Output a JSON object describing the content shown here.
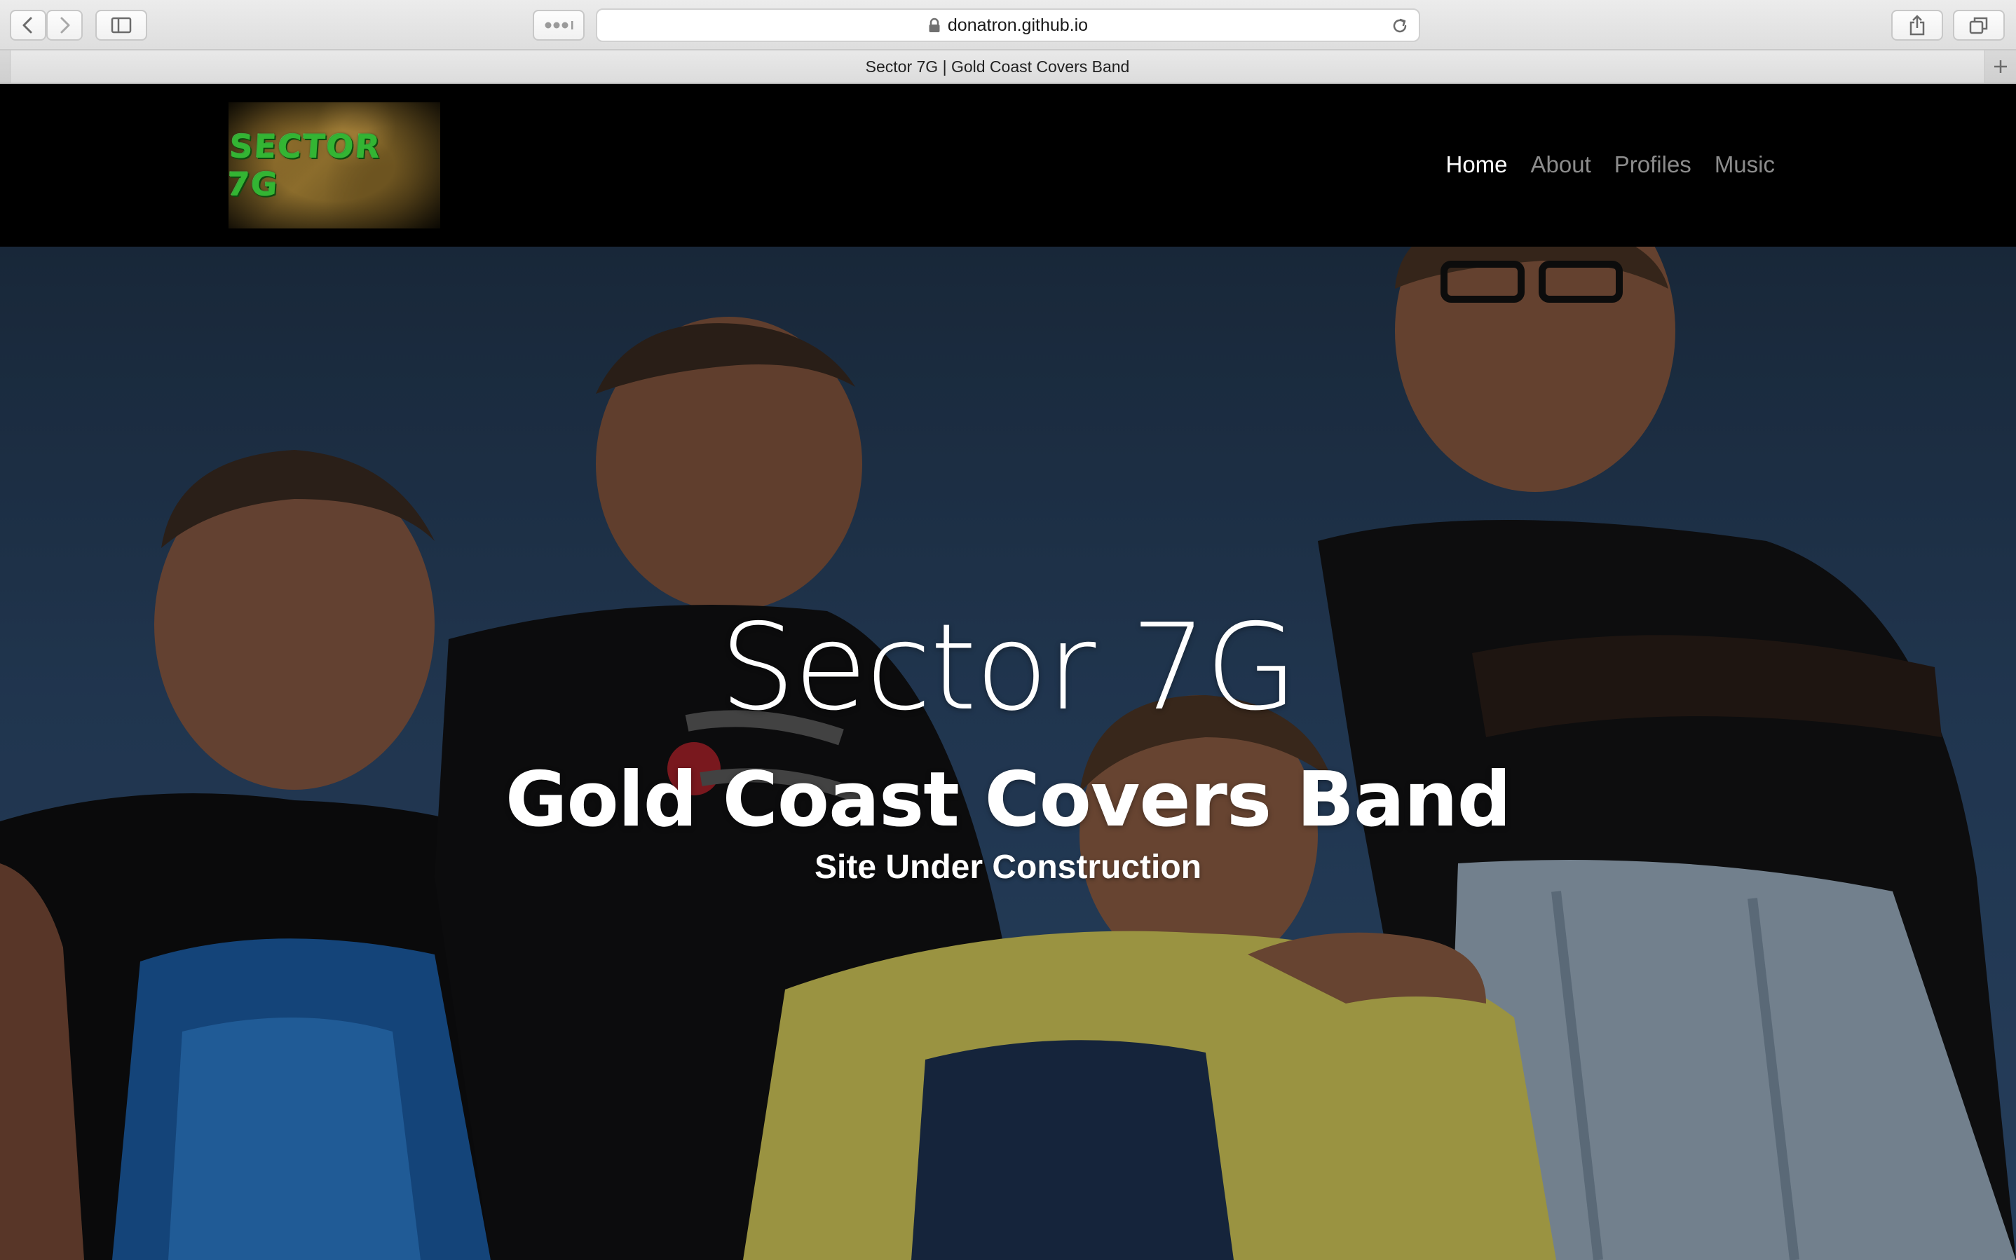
{
  "browser": {
    "url": "donatron.github.io",
    "tab_title": "Sector 7G | Gold Coast Covers Band",
    "icons": {
      "back": "chevron-left-icon",
      "forward": "chevron-right-icon",
      "sidebar": "sidebar-icon",
      "extensions": "ellipsis-icon",
      "lock": "lock-icon",
      "reload": "reload-icon",
      "share": "share-icon",
      "tabs": "tabs-overview-icon",
      "new_tab": "plus-icon"
    }
  },
  "site": {
    "logo_text": "SECTOR 7G",
    "nav": [
      {
        "label": "Home",
        "active": true
      },
      {
        "label": "About",
        "active": false
      },
      {
        "label": "Profiles",
        "active": false
      },
      {
        "label": "Music",
        "active": false
      }
    ],
    "hero": {
      "title": "Sector 7G",
      "subtitle": "Gold Coast Covers Band",
      "note": "Site Under Construction"
    }
  },
  "colors": {
    "nav_active": "#ffffff",
    "nav_inactive": "#8c8c8c",
    "header_bg": "#000000",
    "logo_green": "#33b533"
  }
}
